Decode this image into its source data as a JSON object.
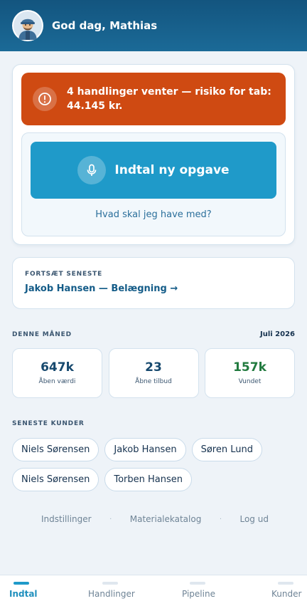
{
  "header": {
    "greeting": "God dag, Mathias",
    "avatar_icon": "worker-avatar-icon"
  },
  "alert": {
    "icon": "alert-circle-icon",
    "text": "4 handlinger venter — risiko for tab: 44.145 kr.",
    "color": "#cf4a12"
  },
  "voice": {
    "icon": "microphone-icon",
    "label": "Indtal ny opgave",
    "hint": "Hvad skal jeg have med?",
    "color": "#1f9ac9"
  },
  "continue": {
    "eyebrow": "FORTSÆT SENESTE",
    "link": "Jakob Hansen — Belægning →"
  },
  "month": {
    "title": "DENNE MÅNED",
    "date": "Juli 2026",
    "stats": [
      {
        "value": "647k",
        "label": "Åben værdi"
      },
      {
        "value": "23",
        "label": "Åbne tilbud"
      },
      {
        "value": "157k",
        "label": "Vundet"
      }
    ]
  },
  "customers": {
    "title": "SENESTE KUNDER",
    "items": [
      "Niels Sørensen",
      "Jakob Hansen",
      "Søren Lund",
      "Niels Sørensen",
      "Torben Hansen"
    ]
  },
  "footer": {
    "links": [
      "Indstillinger",
      "Materialekatalog",
      "Log ud"
    ],
    "separator": "·"
  },
  "tabs": {
    "items": [
      "Indtal",
      "Handlinger",
      "Pipeline",
      "Kunder"
    ],
    "active": "Indtal"
  }
}
